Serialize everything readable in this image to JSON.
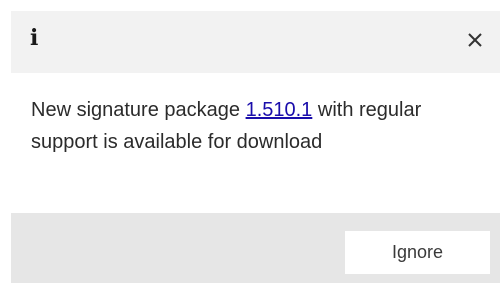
{
  "notification": {
    "icon": "info-icon",
    "icon_glyph": "i",
    "close_icon": "close-icon",
    "message": {
      "prefix": "New signature package ",
      "link_text": "1.510.1",
      "suffix": " with regular support is available for download"
    },
    "ignore_label": "Ignore"
  },
  "colors": {
    "header_bg": "#f2f2f2",
    "footer_bg": "#e6e6e6",
    "link": "#1a0dab",
    "text": "#2b2b2b"
  }
}
